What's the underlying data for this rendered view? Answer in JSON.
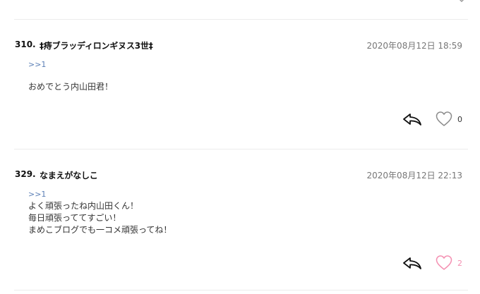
{
  "comments": [
    {
      "number": "310.",
      "author": "‡痔ブラッディロンギヌス3世‡",
      "date": "2020年08月12日 18:59",
      "reply_to": ">>1",
      "lines": [
        "おめでとう内山田君！"
      ],
      "likes": "0",
      "liked": false
    },
    {
      "number": "329.",
      "author": "なまえがなしこ",
      "date": "2020年08月12日 22:13",
      "reply_to": ">>1",
      "lines": [
        "よく頑張ったね内山田くん！",
        "毎日頑張っててすごい！",
        "まめこブログでも一コメ頑張ってね！"
      ],
      "likes": "2",
      "liked": true
    }
  ],
  "colors": {
    "reply_link": "#5b7fb6",
    "liked_heart": "#f48fb1",
    "unliked_heart": "#8c8c8c",
    "divider": "#ececec"
  },
  "icons": {
    "top": "chevron-down-icon",
    "reply": "reply-arrow-icon",
    "like": "heart-outline-icon"
  }
}
